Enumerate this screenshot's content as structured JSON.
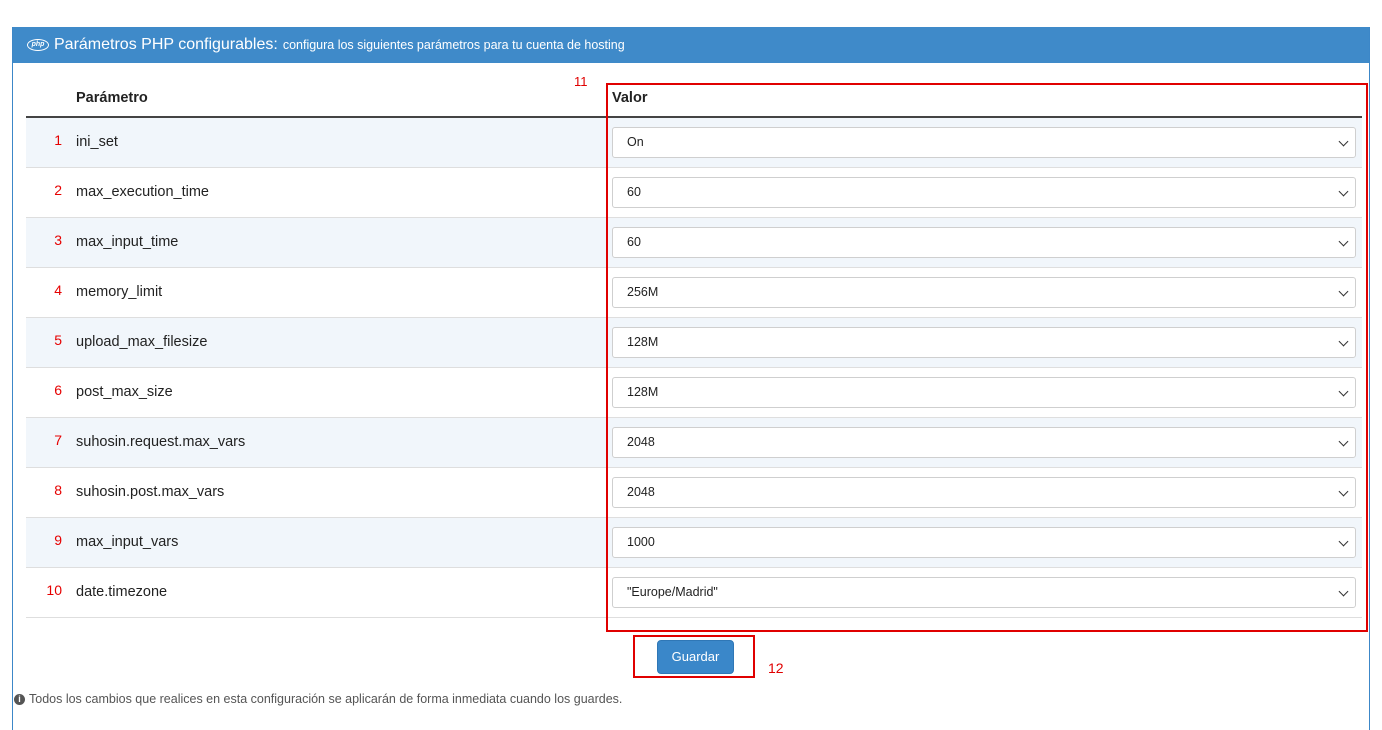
{
  "panel": {
    "title": "Parámetros PHP configurables:",
    "subtitle": "configura los siguientes parámetros para tu cuenta de hosting",
    "icon": "php-icon",
    "accent_color": "#3f8ac9"
  },
  "table": {
    "col_param": "Parámetro",
    "col_valor": "Valor",
    "rows": [
      {
        "num": "1",
        "name": "ini_set",
        "value": "On"
      },
      {
        "num": "2",
        "name": "max_execution_time",
        "value": "60"
      },
      {
        "num": "3",
        "name": "max_input_time",
        "value": "60"
      },
      {
        "num": "4",
        "name": "memory_limit",
        "value": "256M"
      },
      {
        "num": "5",
        "name": "upload_max_filesize",
        "value": "128M"
      },
      {
        "num": "6",
        "name": "post_max_size",
        "value": "128M"
      },
      {
        "num": "7",
        "name": "suhosin.request.max_vars",
        "value": "2048"
      },
      {
        "num": "8",
        "name": "suhosin.post.max_vars",
        "value": "2048"
      },
      {
        "num": "9",
        "name": "max_input_vars",
        "value": "1000"
      },
      {
        "num": "10",
        "name": "date.timezone",
        "value": "\"Europe/Madrid\""
      }
    ]
  },
  "annotations": {
    "valor_label": "11",
    "button_label": "12",
    "highlight_color": "#e00000"
  },
  "actions": {
    "save_label": "Guardar"
  },
  "footnote": {
    "text": "Todos los cambios que realices en esta configuración se aplicarán de forma inmediata cuando los guardes.",
    "icon": "info-icon"
  }
}
